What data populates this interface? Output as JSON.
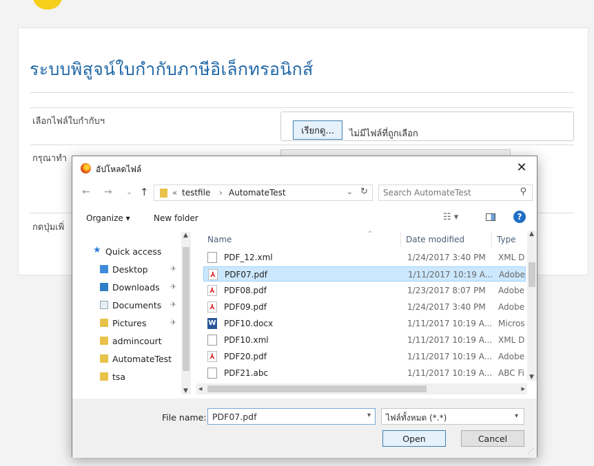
{
  "page": {
    "title": "ระบบพิสูจน์ใบกำกับภาษีอิเล็กทรอนิกส์",
    "row1_label": "เลือกไฟล์ใบกำกับฯ",
    "browse_label": "เรียกดู...",
    "no_file_text": "ไม่มีไฟล์ที่ถูกเลือก",
    "row2_label": "กรุณาทำ",
    "row3_label": "กดปุ่มเพิ่"
  },
  "dialog": {
    "title": "อัปโหลดไฟล์",
    "close": "✕",
    "nav": {
      "back": "←",
      "forward": "→",
      "recent": "⌄",
      "up": "↑",
      "crumb_prefix": "«",
      "crumbs": [
        "testfile",
        "AutomateTest"
      ],
      "crumb_sep": "›",
      "search_placeholder": "Search AutomateTest"
    },
    "toolbar": {
      "organize": "Organize ▾",
      "new_folder": "New folder",
      "view": "☷ ▾",
      "help": "?"
    },
    "nav_pane": {
      "items": [
        {
          "label": "Quick access",
          "pin": ""
        },
        {
          "label": "Desktop",
          "pin": "✈"
        },
        {
          "label": "Downloads",
          "pin": "✈"
        },
        {
          "label": "Documents",
          "pin": "✈"
        },
        {
          "label": "Pictures",
          "pin": "✈"
        },
        {
          "label": "admincourt",
          "pin": ""
        },
        {
          "label": "AutomateTest",
          "pin": ""
        },
        {
          "label": "tsa",
          "pin": ""
        }
      ]
    },
    "columns": {
      "name": "Name",
      "date": "Date modified",
      "type": "Type"
    },
    "files": [
      {
        "name": "PDF_12.xml",
        "date": "1/24/2017 3:40 PM",
        "type": "XML D",
        "kind": "xml",
        "selected": false
      },
      {
        "name": "PDF07.pdf",
        "date": "1/11/2017 10:19 A...",
        "type": "Adobe",
        "kind": "pdf",
        "selected": true
      },
      {
        "name": "PDF08.pdf",
        "date": "1/23/2017 8:07 PM",
        "type": "Adobe",
        "kind": "pdf",
        "selected": false
      },
      {
        "name": "PDF09.pdf",
        "date": "1/24/2017 3:40 PM",
        "type": "Adobe",
        "kind": "pdf",
        "selected": false
      },
      {
        "name": "PDF10.docx",
        "date": "1/11/2017 10:19 A...",
        "type": "Micros",
        "kind": "docx",
        "selected": false
      },
      {
        "name": "PDF10.xml",
        "date": "1/11/2017 10:19 A...",
        "type": "XML D",
        "kind": "xml",
        "selected": false
      },
      {
        "name": "PDF20.pdf",
        "date": "1/11/2017 10:19 A...",
        "type": "Adobe",
        "kind": "pdf",
        "selected": false
      },
      {
        "name": "PDF21.abc",
        "date": "1/11/2017 10:19 A...",
        "type": "ABC Fi",
        "kind": "abc",
        "selected": false
      }
    ],
    "file_name_label": "File name:",
    "file_name_value": "PDF07.pdf",
    "file_type_value": "ไฟล์ทั้งหมด (*.*)",
    "open_label": "Open",
    "cancel_label": "Cancel"
  },
  "colors": {
    "title_blue": "#2268a6",
    "selection": "#cce8ff",
    "accent": "#1f6fc4"
  }
}
